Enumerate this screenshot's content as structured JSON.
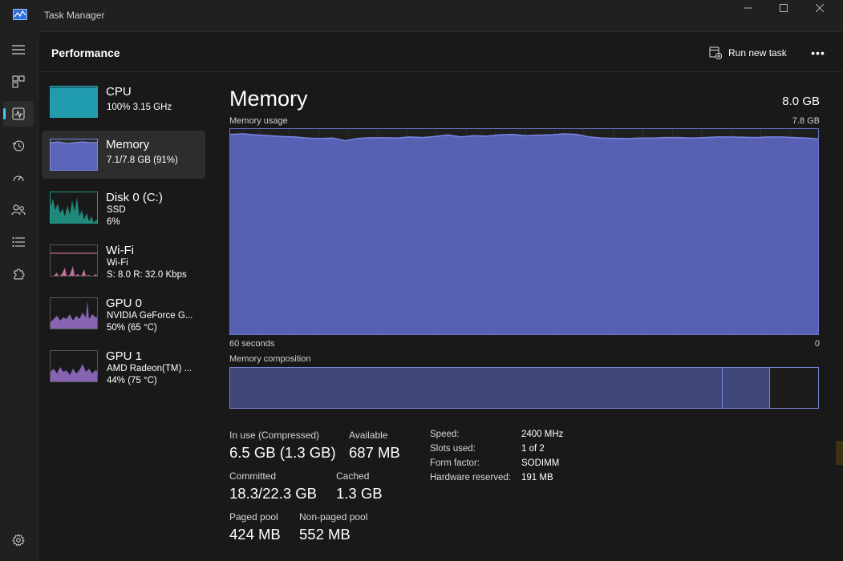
{
  "window": {
    "title": "Task Manager"
  },
  "header": {
    "page_title": "Performance",
    "run_new_task": "Run new task",
    "more_label": "•••"
  },
  "devices": [
    {
      "name": "CPU",
      "line1": "100%  3.15 GHz",
      "line2": ""
    },
    {
      "name": "Memory",
      "line1": "7.1/7.8 GB (91%)",
      "line2": ""
    },
    {
      "name": "Disk 0 (C:)",
      "line1": "SSD",
      "line2": "6%"
    },
    {
      "name": "Wi-Fi",
      "line1": "Wi-Fi",
      "line2": "S: 8.0  R: 32.0 Kbps"
    },
    {
      "name": "GPU 0",
      "line1": "NVIDIA GeForce G...",
      "line2": "50%  (65 °C)"
    },
    {
      "name": "GPU 1",
      "line1": "AMD Radeon(TM) ...",
      "line2": "44%  (75 °C)"
    }
  ],
  "detail": {
    "title": "Memory",
    "total": "8.0 GB",
    "usage_label": "Memory usage",
    "usage_max": "7.8 GB",
    "time_left": "60 seconds",
    "time_right": "0",
    "composition_label": "Memory composition"
  },
  "stats": {
    "in_use_label": "In use (Compressed)",
    "in_use_value": "6.5 GB (1.3 GB)",
    "available_label": "Available",
    "available_value": "687 MB",
    "committed_label": "Committed",
    "committed_value": "18.3/22.3 GB",
    "cached_label": "Cached",
    "cached_value": "1.3 GB",
    "paged_label": "Paged pool",
    "paged_value": "424 MB",
    "nonpaged_label": "Non-paged pool",
    "nonpaged_value": "552 MB"
  },
  "specs": [
    {
      "label": "Speed:",
      "value": "2400 MHz"
    },
    {
      "label": "Slots used:",
      "value": "1 of 2"
    },
    {
      "label": "Form factor:",
      "value": "SODIMM"
    },
    {
      "label": "Hardware reserved:",
      "value": "191 MB"
    }
  ],
  "memory_history": [
    7.6,
    7.62,
    7.58,
    7.55,
    7.52,
    7.5,
    7.46,
    7.44,
    7.46,
    7.36,
    7.45,
    7.47,
    7.47,
    7.46,
    7.5,
    7.48,
    7.52,
    7.58,
    7.5,
    7.55,
    7.53,
    7.58,
    7.6,
    7.55,
    7.57,
    7.58,
    7.62,
    7.6,
    7.5,
    7.46,
    7.45,
    7.44,
    7.46,
    7.46,
    7.48,
    7.48,
    7.46,
    7.48,
    7.5,
    7.5,
    7.49,
    7.48,
    7.5,
    7.5,
    7.48,
    7.46,
    7.42
  ],
  "composition": {
    "in_use_fraction": 0.838,
    "modified_fraction": 0.08
  },
  "colors": {
    "cpu": "#1fa3b8",
    "memory": "#7986e6",
    "disk": "#1f9c8c",
    "wifi": "#e87bb6",
    "gpu": "#a77fd8",
    "accent": "#4cc2ff"
  }
}
